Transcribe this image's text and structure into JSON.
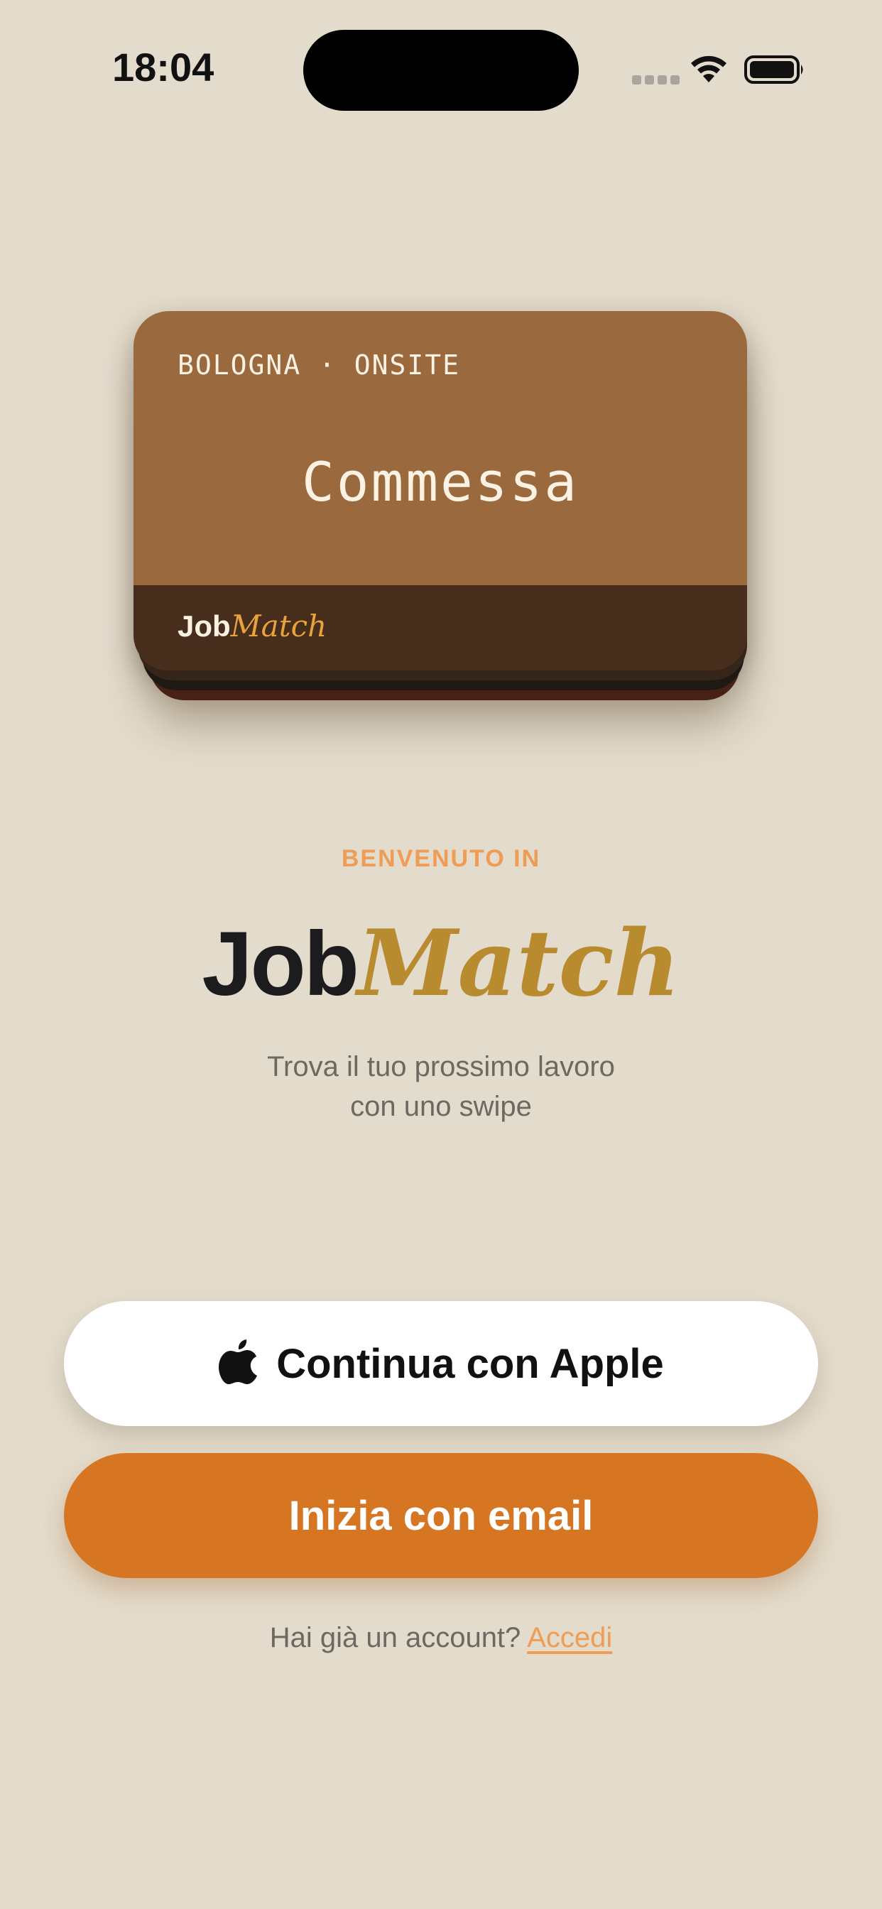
{
  "status_bar": {
    "time": "18:04",
    "wifi_icon": "wifi-icon",
    "battery_icon": "battery-icon",
    "signal_icon": "cellular-signal-icon"
  },
  "card": {
    "meta": "BOLOGNA · ONSITE",
    "title": "Commessa",
    "logo_job": "Job",
    "logo_match": "Match",
    "colors": {
      "front": "#9a6a3e",
      "footer": "#472d1c",
      "accent": "#e8a33a"
    }
  },
  "welcome": {
    "label": "BENVENUTO IN",
    "brand_job": "Job",
    "brand_match": "Match",
    "tagline_line1": "Trova il tuo prossimo lavoro",
    "tagline_line2": "con uno swipe"
  },
  "actions": {
    "apple_label": "Continua con Apple",
    "apple_icon": "apple-logo-icon",
    "email_label": "Inizia con email",
    "login_prompt": "Hai già un account?",
    "login_link": "Accedi"
  },
  "theme": {
    "background": "#e3dbcb",
    "primary": "#d67622",
    "accent_light": "#ee9c56",
    "brand_gold": "#b98b2f"
  }
}
